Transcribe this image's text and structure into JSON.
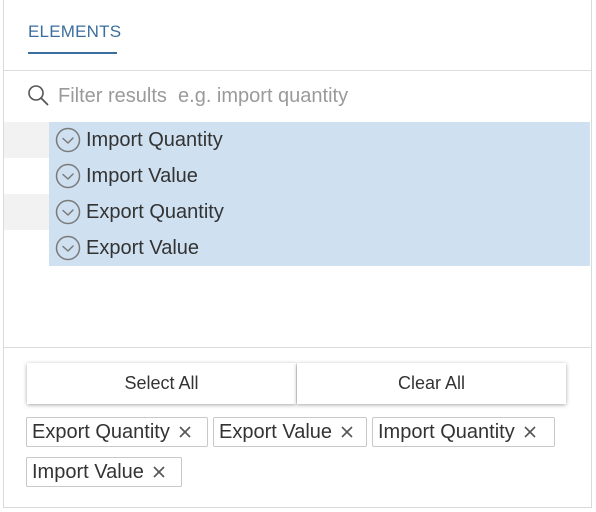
{
  "header": {
    "tab_label": "ELEMENTS"
  },
  "search": {
    "placeholder": "Filter results  e.g. import quantity",
    "value": ""
  },
  "list": {
    "items": [
      {
        "label": "Import Quantity",
        "selected": true
      },
      {
        "label": "Import Value",
        "selected": true
      },
      {
        "label": "Export Quantity",
        "selected": true
      },
      {
        "label": "Export Value",
        "selected": true
      }
    ]
  },
  "actions": {
    "select_all_label": "Select All",
    "clear_all_label": "Clear All"
  },
  "chips": [
    {
      "label": "Export Quantity"
    },
    {
      "label": "Export Value"
    },
    {
      "label": "Import Quantity"
    },
    {
      "label": "Import Value"
    }
  ],
  "colors": {
    "accent": "#3b6e9f",
    "selection": "#cfe0f1",
    "stripe": "#f2f2f2"
  }
}
